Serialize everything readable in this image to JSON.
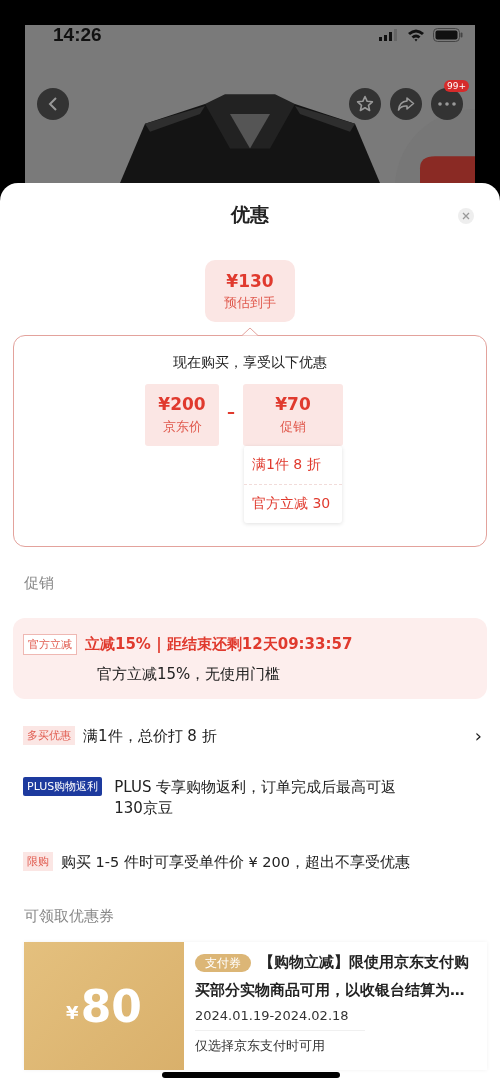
{
  "status_bar": {
    "time": "14:26"
  },
  "product_nav": {
    "more_badge": "99+"
  },
  "sheet": {
    "title": "优惠"
  },
  "estimate": {
    "price": "¥130",
    "label": "预估到手"
  },
  "breakdown": {
    "heading": "现在购买，享受以下优惠",
    "operator": "–",
    "base": {
      "price": "¥200",
      "label": "京东价"
    },
    "promo": {
      "price": "¥70",
      "label": "促销"
    },
    "details": [
      "满1件 8 折",
      "官方立减 30"
    ]
  },
  "promotions": {
    "section_title": "促销",
    "items": [
      {
        "kind": "highlight",
        "tag": "官方立减",
        "headline": "立减15% | 距结束还剩12天09:33:57",
        "text": "官方立减15%，无使用门槛"
      },
      {
        "kind": "link",
        "tag": "多买优惠",
        "text": "满1件，总价打 8 折",
        "arrow": "›"
      },
      {
        "kind": "plus",
        "tag": "PLUS购物返利",
        "text": "PLUS 专享购物返利，订单完成后最高可返130京豆"
      },
      {
        "kind": "plain",
        "tag": "限购",
        "text": "购买 1-5 件时可享受单件价 ¥ 200，超出不享受优惠"
      }
    ]
  },
  "coupons": {
    "section_title": "可领取优惠券",
    "items": [
      {
        "currency": "¥",
        "amount": "80",
        "tag": "支付券",
        "title": "【购物立减】限使用京东支付购买部分实物商品可用，以收银台结算为…",
        "dates": "2024.01.19-2024.02.18",
        "note": "仅选择京东支付时可用"
      }
    ]
  }
}
